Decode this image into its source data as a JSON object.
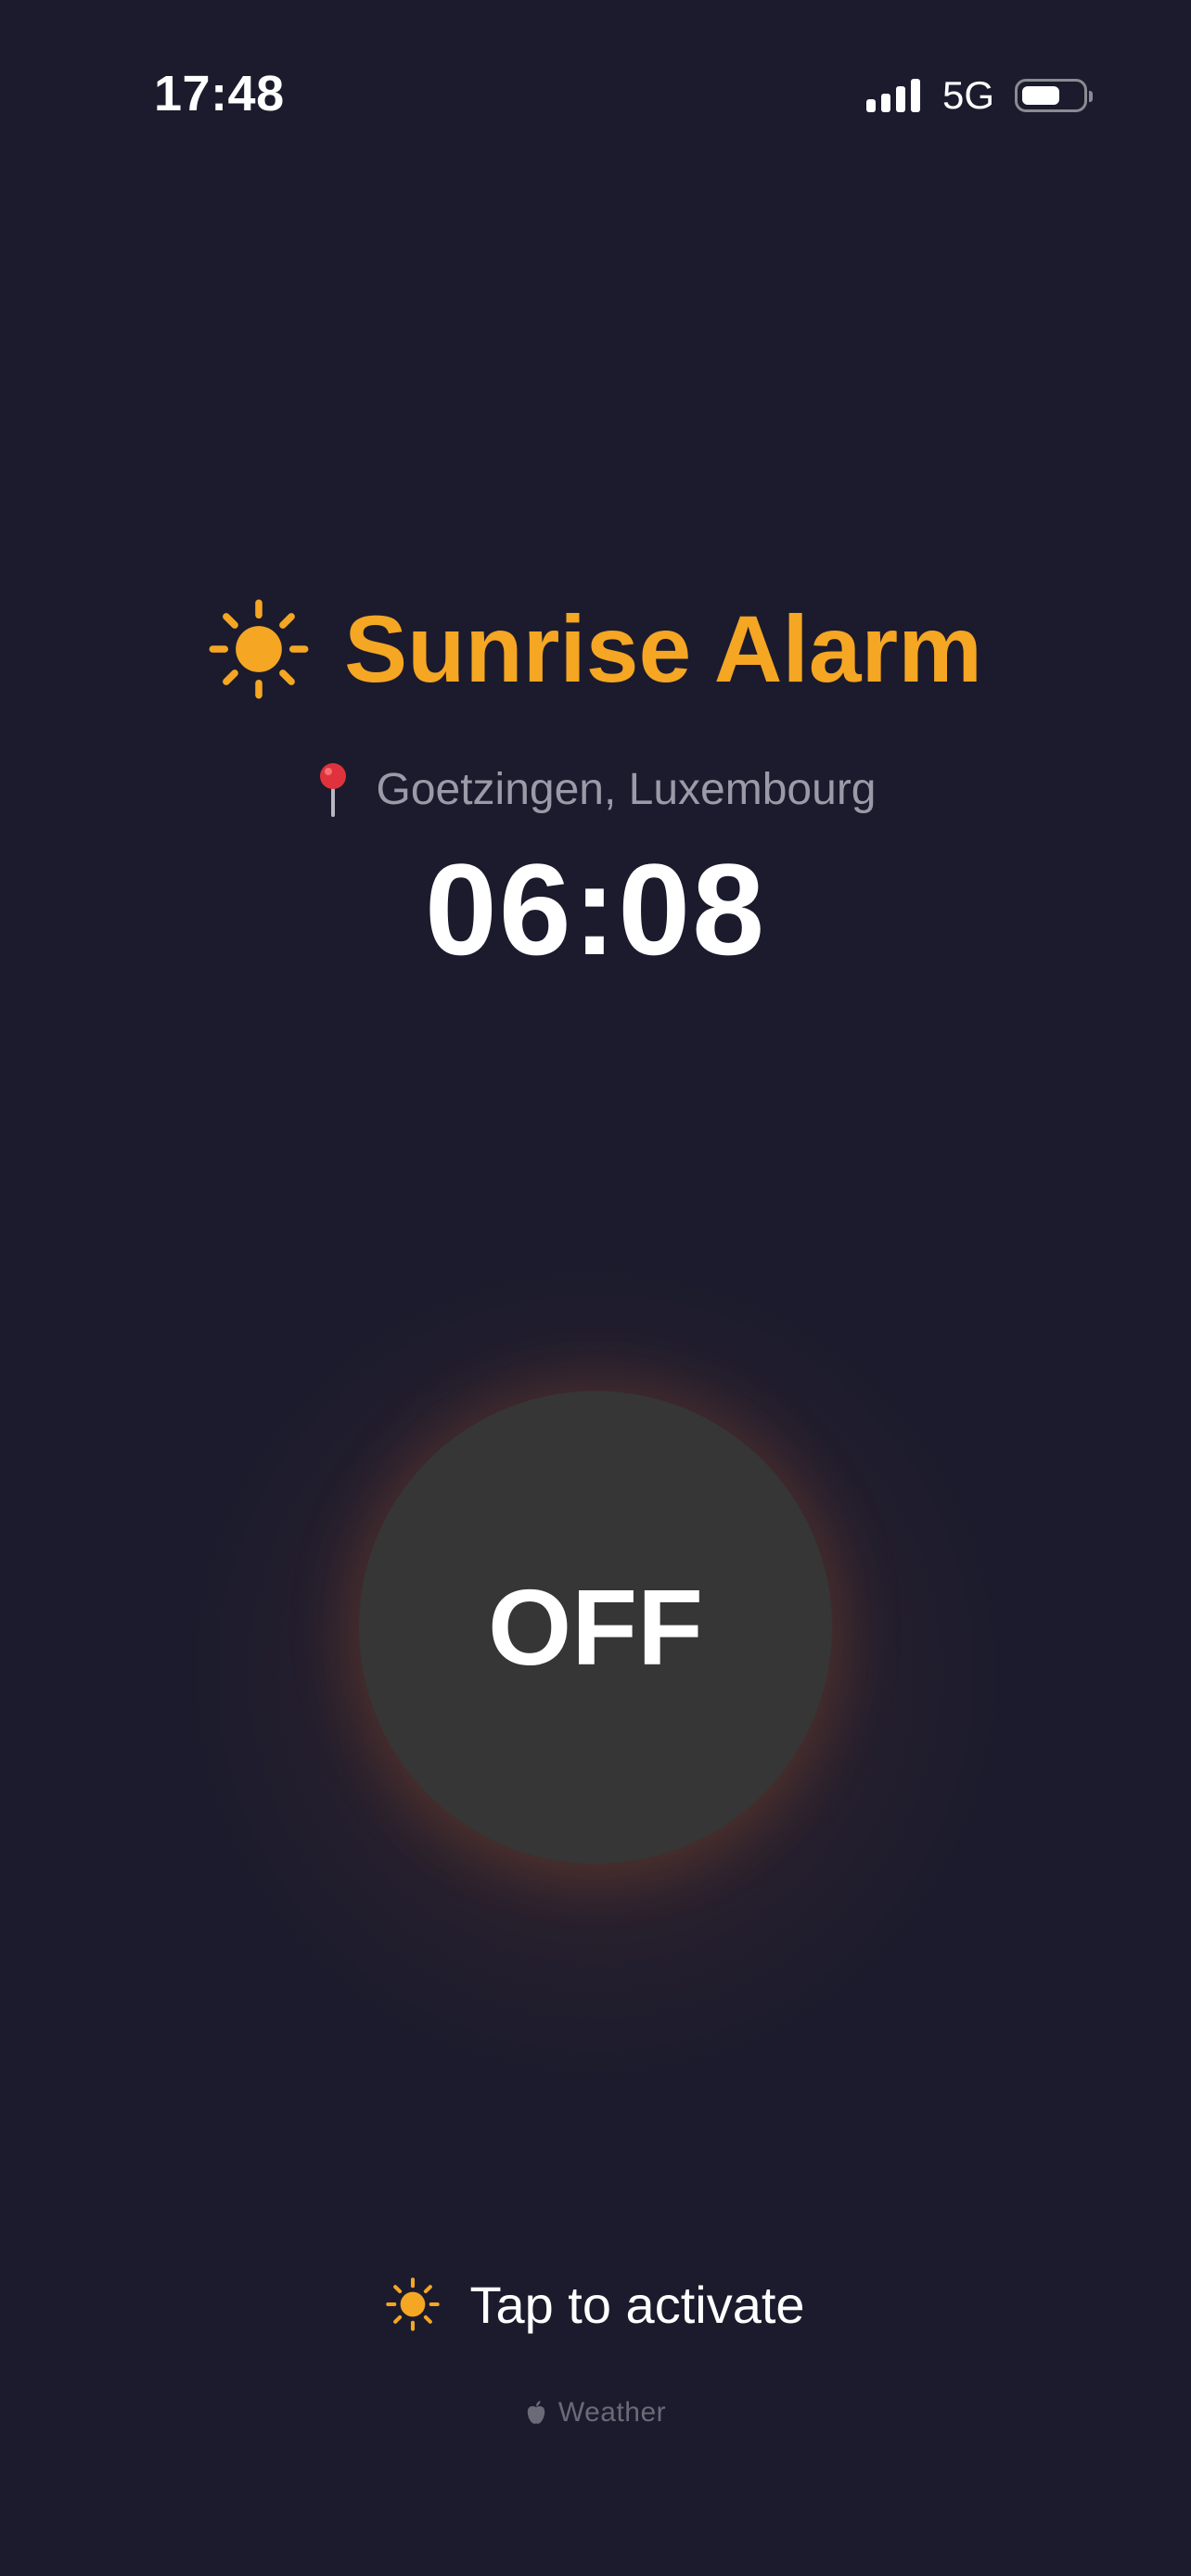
{
  "status_bar": {
    "time": "17:48",
    "network": "5G",
    "signal_bars": 4,
    "battery_level": 0.65
  },
  "header": {
    "title": "Sunrise Alarm",
    "icon": "sun-icon"
  },
  "location": {
    "icon": "pin-icon",
    "text": "Goetzingen, Luxembourg"
  },
  "alarm": {
    "time": "06:08",
    "state_label": "OFF"
  },
  "hint": {
    "icon": "sun-icon",
    "text": "Tap to activate"
  },
  "attribution": {
    "icon": "apple-icon",
    "text": "Weather"
  },
  "colors": {
    "background": "#1b1b2d",
    "accent": "#f5a623",
    "toggle": "#363636",
    "muted": "#9a9aa8"
  }
}
